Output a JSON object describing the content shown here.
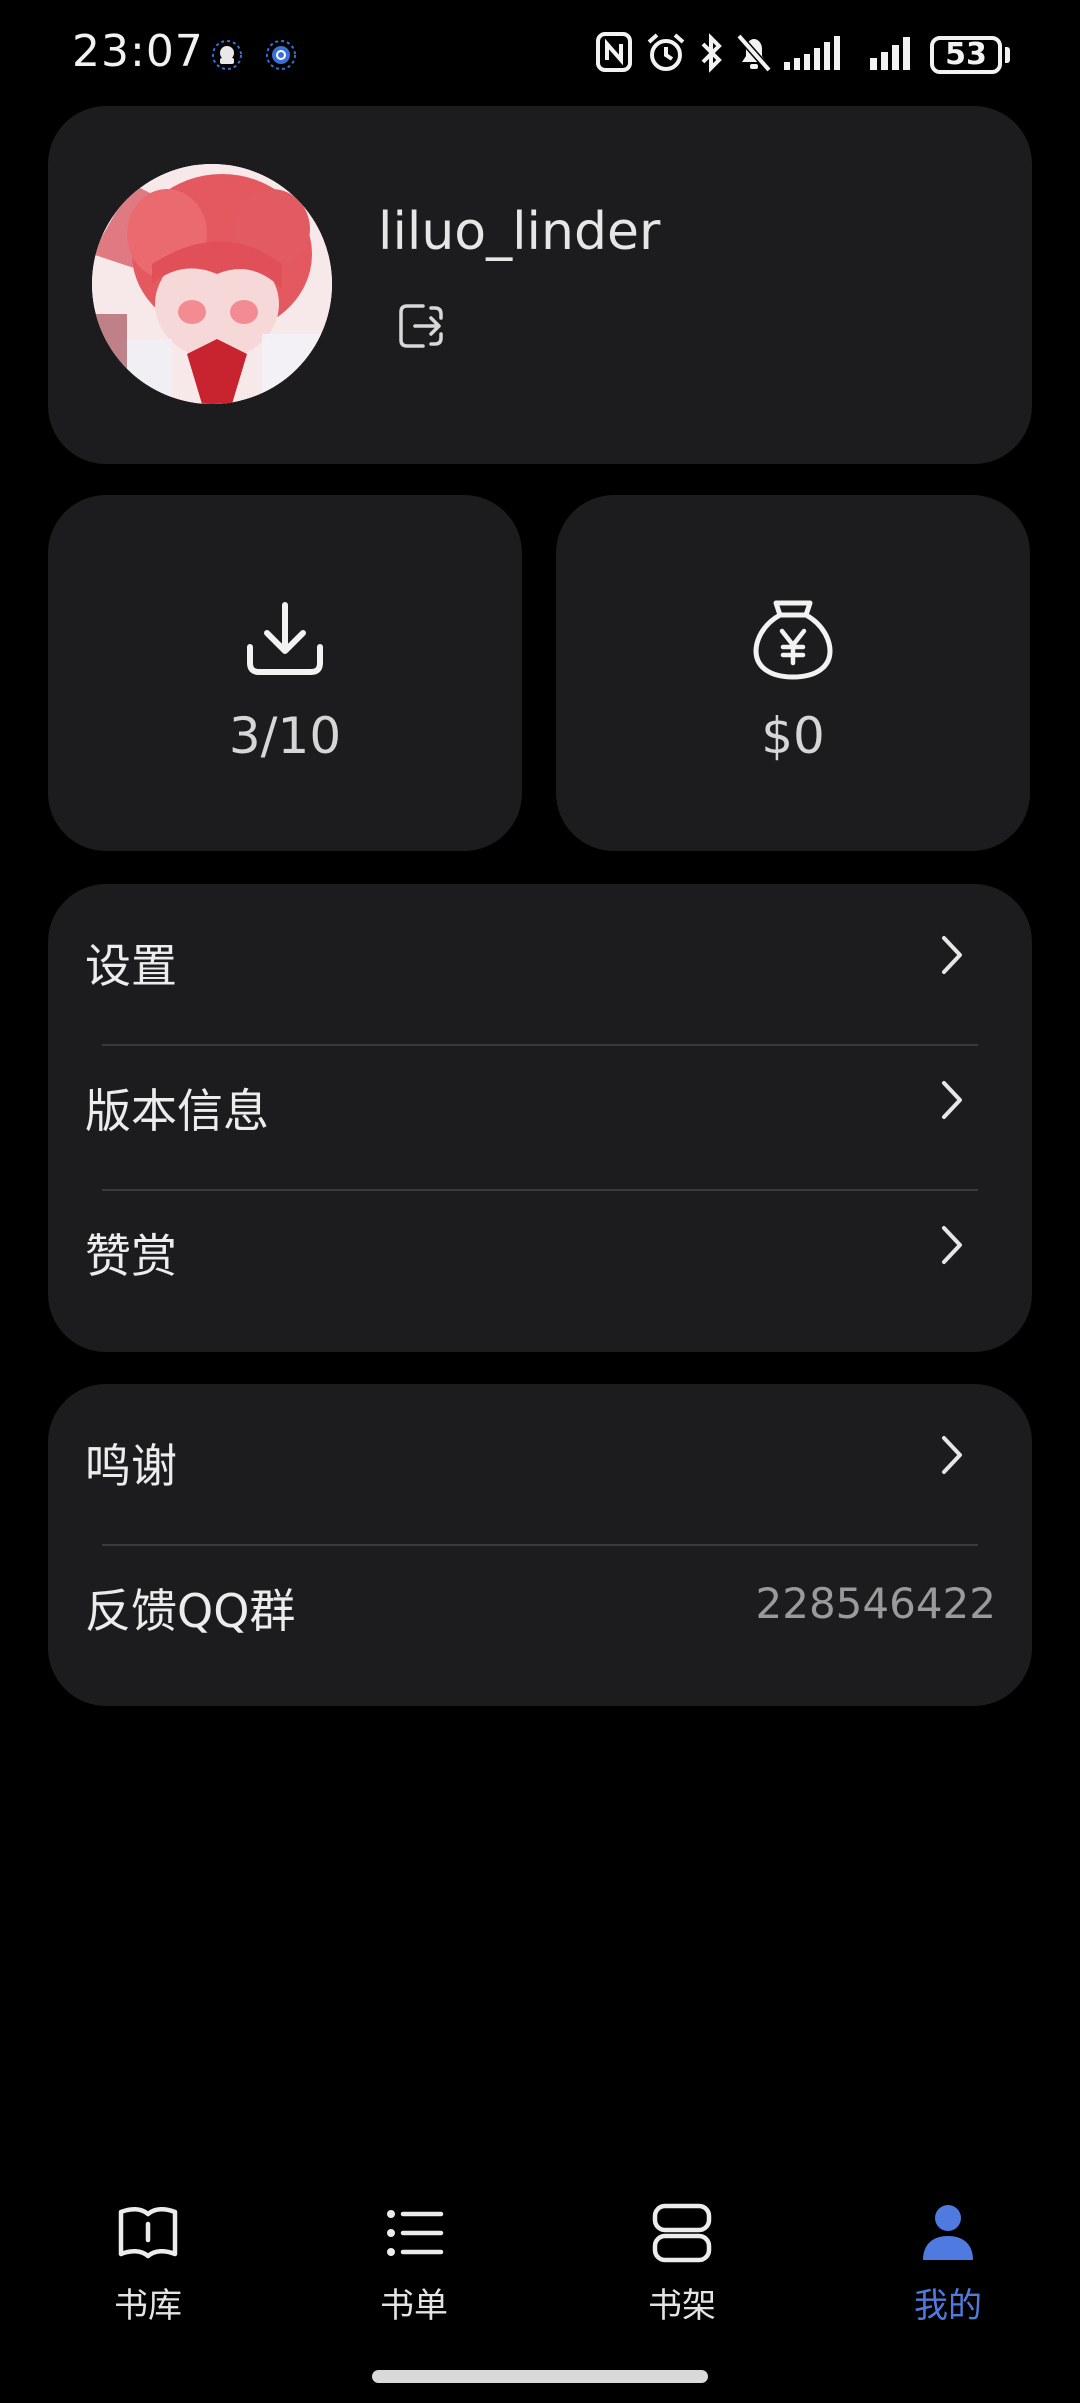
{
  "status_bar": {
    "time": "23:07",
    "battery": "53",
    "icons": [
      "app-notification-icon",
      "app-notification-icon",
      "nfc-icon",
      "alarm-icon",
      "bluetooth-icon",
      "mute-icon",
      "signal-icon",
      "signal-icon",
      "battery-icon"
    ]
  },
  "profile": {
    "username": "liluo_linder",
    "avatar_icon": "avatar",
    "logout_icon": "logout-icon"
  },
  "stats": {
    "downloads": {
      "icon": "download-icon",
      "value": "3/10"
    },
    "wallet": {
      "icon": "money-bag-icon",
      "value": "$0"
    }
  },
  "menu": {
    "items": [
      {
        "label": "设置"
      },
      {
        "label": "版本信息"
      },
      {
        "label": "赞赏"
      }
    ]
  },
  "info": {
    "items": [
      {
        "label": "鸣谢"
      },
      {
        "label": "反馈QQ群",
        "value": "228546422"
      }
    ]
  },
  "bottom_nav": {
    "active_color": "#4f7be0",
    "items": [
      {
        "label": "书库",
        "icon": "book-icon"
      },
      {
        "label": "书单",
        "icon": "list-icon"
      },
      {
        "label": "书架",
        "icon": "bookshelf-icon"
      },
      {
        "label": "我的",
        "icon": "user-icon",
        "active": true
      }
    ]
  }
}
